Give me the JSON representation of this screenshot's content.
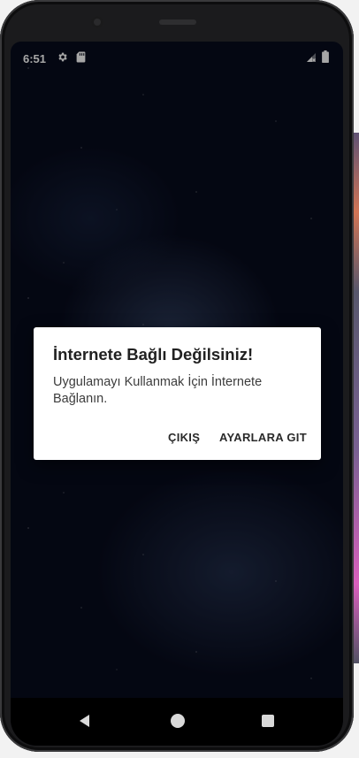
{
  "status_bar": {
    "time": "6:51",
    "icons": [
      "gear-icon",
      "sd-card-icon",
      "signal-icon",
      "battery-icon"
    ]
  },
  "dialog": {
    "title": "İnternete Bağlı Değilsiniz!",
    "message": "Uygulamayı Kullanmak İçin İnternete Bağlanın.",
    "negative_label": "ÇIKIŞ",
    "positive_label": "AYARLARA GIT"
  },
  "nav_bar": {
    "icons": [
      "back-icon",
      "home-icon",
      "recents-icon"
    ]
  },
  "colors": {
    "background_sky": "#070b1c",
    "dialog_bg": "#ffffff",
    "text_primary": "#212121"
  }
}
